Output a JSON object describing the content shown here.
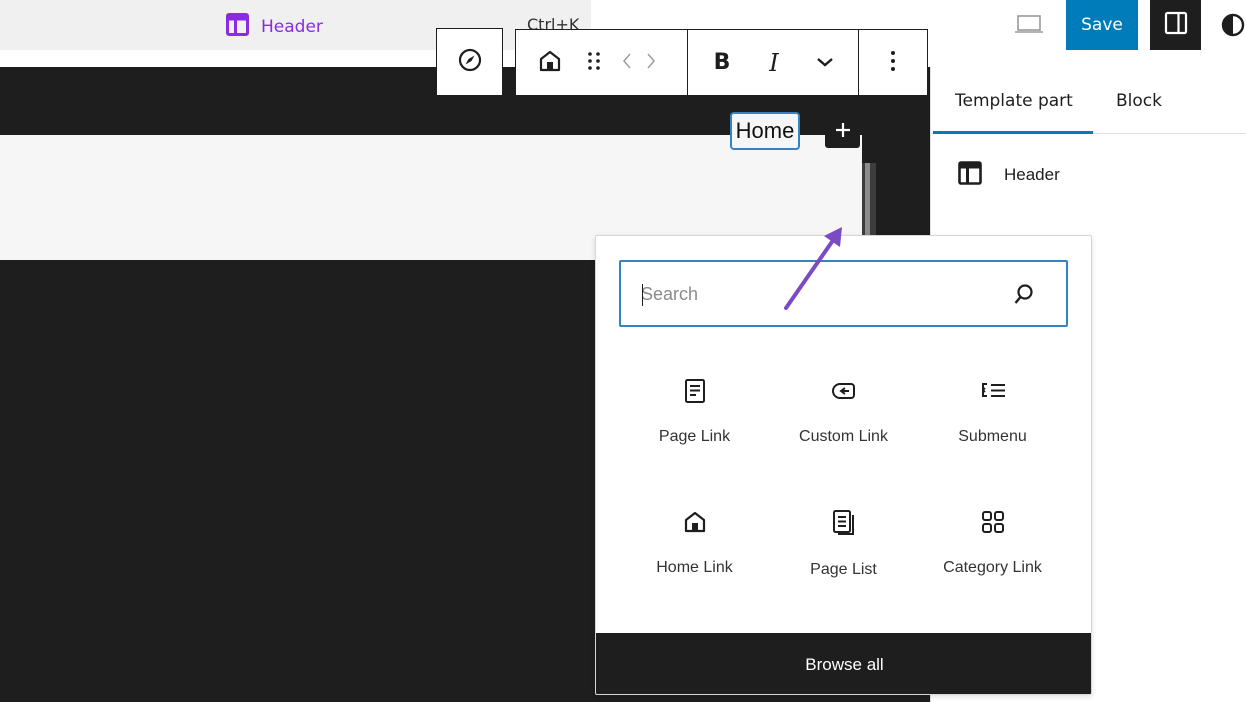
{
  "topbar": {
    "document_title": "Header",
    "shortcut": "Ctrl+K",
    "save_label": "Save",
    "accent_color": "#8a2be2",
    "save_color": "#007cba"
  },
  "canvas": {
    "nav_item_label": "Home"
  },
  "block_toolbar": {
    "buttons": [
      "parent-navigation-icon",
      "home-icon",
      "drag-handle-icon",
      "move-arrows-icon",
      "bold",
      "italic",
      "chevron-down-icon",
      "more-options-icon"
    ],
    "bold_label": "B",
    "italic_label": "I"
  },
  "sidebar": {
    "tabs": [
      {
        "label": "Template part",
        "active": true
      },
      {
        "label": "Block",
        "active": false
      }
    ],
    "item_label": "Header"
  },
  "inserter": {
    "search_placeholder": "Search",
    "blocks": [
      {
        "label": "Page Link",
        "icon": "page-icon"
      },
      {
        "label": "Custom Link",
        "icon": "custom-link-icon"
      },
      {
        "label": "Submenu",
        "icon": "submenu-icon"
      },
      {
        "label": "Home Link",
        "icon": "home-icon"
      },
      {
        "label": "Page List",
        "icon": "page-list-icon"
      },
      {
        "label": "Category Link",
        "icon": "category-icon"
      }
    ],
    "browse_all_label": "Browse all"
  },
  "annotation": {
    "arrow_color": "#7b4bc4"
  }
}
